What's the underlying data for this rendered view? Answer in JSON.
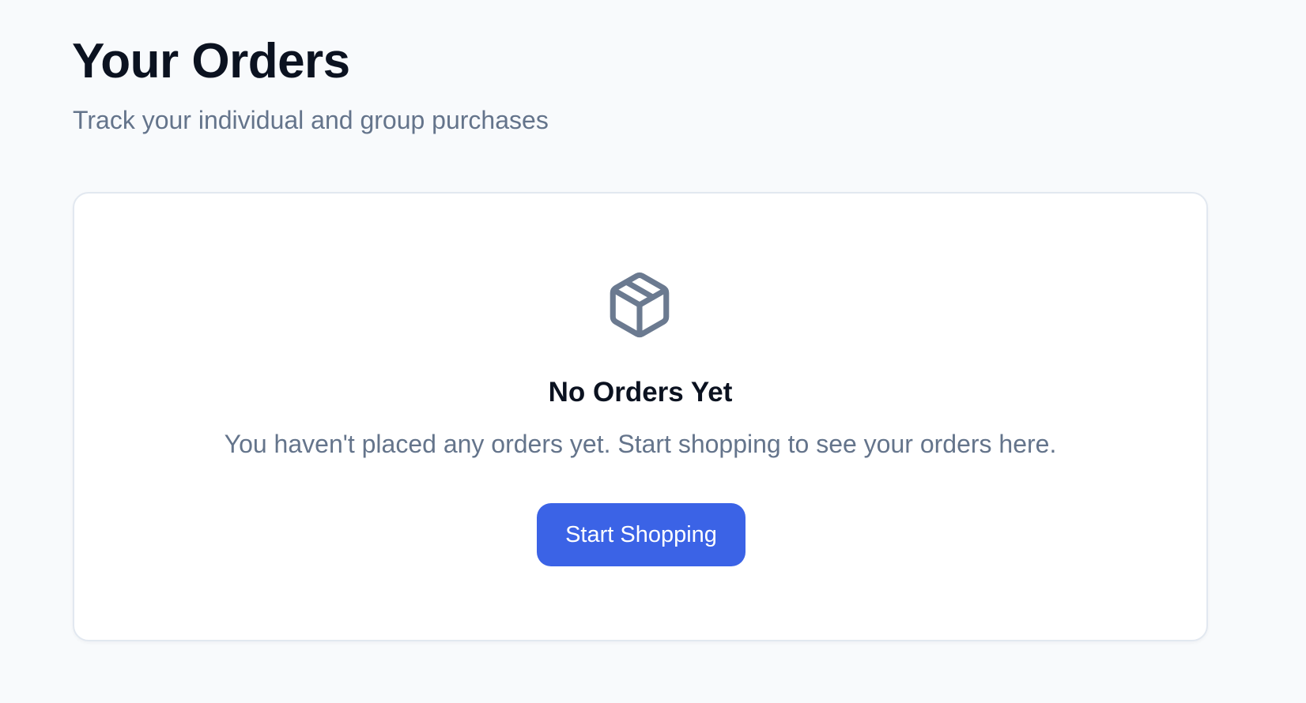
{
  "header": {
    "title": "Your Orders",
    "subtitle": "Track your individual and group purchases"
  },
  "empty_state": {
    "icon": "package-icon",
    "icon_color": "#6b7a90",
    "title": "No Orders Yet",
    "message": "You haven't placed any orders yet. Start shopping to see your orders here.",
    "button_label": "Start Shopping",
    "button_color": "#3b63e6"
  }
}
